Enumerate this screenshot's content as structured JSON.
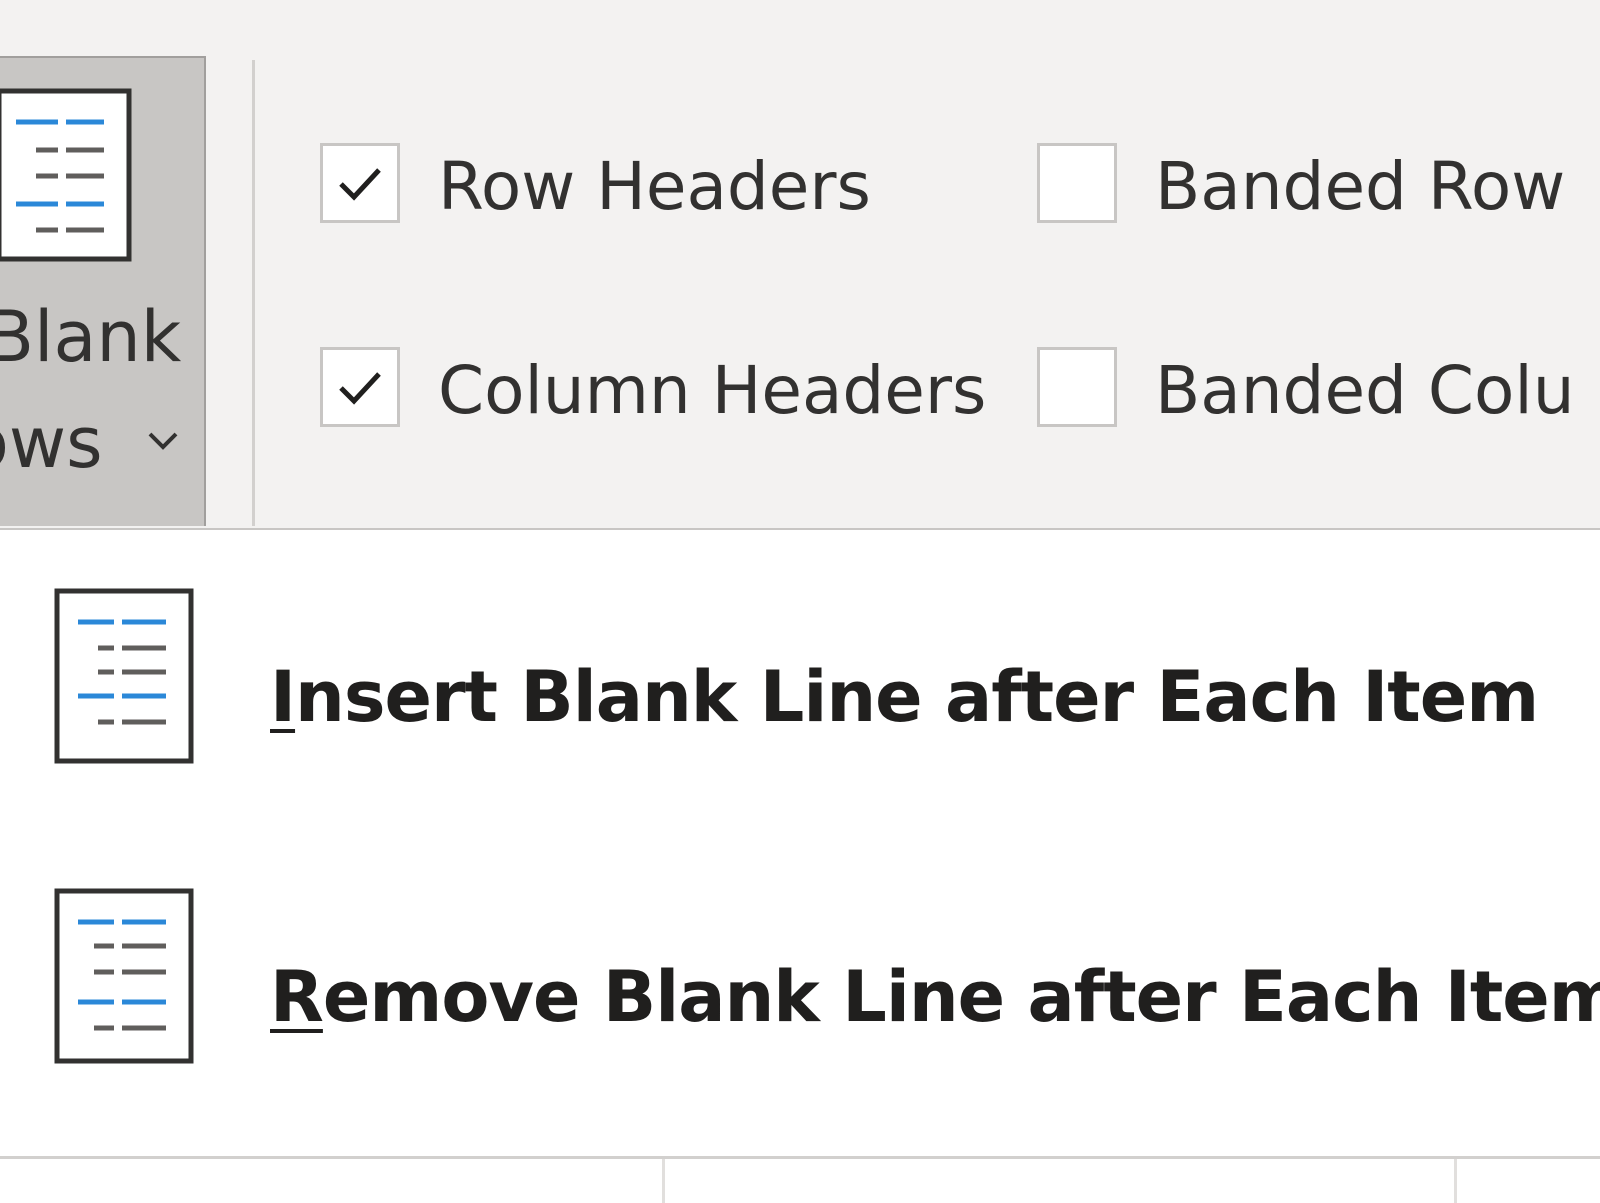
{
  "ribbon": {
    "blank_rows_button": {
      "line1": "Blank",
      "line2": "ows",
      "icon": "blank-rows-icon",
      "dropdown_icon": "chevron-down-icon"
    },
    "style_options": {
      "row_headers": {
        "label": "Row Headers",
        "checked": true
      },
      "column_headers": {
        "label": "Column Headers",
        "checked": true
      },
      "banded_rows": {
        "label": "Banded Row",
        "checked": false
      },
      "banded_columns": {
        "label": "Banded Colu",
        "checked": false
      }
    }
  },
  "menu": {
    "items": [
      {
        "mnemonic": "I",
        "rest": "nsert Blank Line after Each Item",
        "icon": "insert-blank-line-icon"
      },
      {
        "mnemonic": "R",
        "rest": "emove Blank Line after Each Item",
        "icon": "remove-blank-line-icon"
      }
    ]
  },
  "colors": {
    "accent_blue": "#2b88d8",
    "ribbon_bg": "#f3f2f1",
    "pressed_bg": "#c8c6c4",
    "text": "#323130"
  }
}
